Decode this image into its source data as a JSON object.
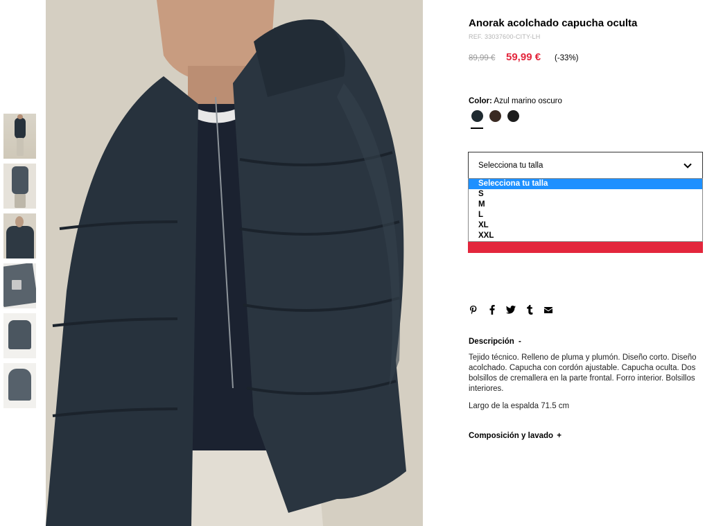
{
  "thumbnails": [
    {
      "alt": "thumbnail-1"
    },
    {
      "alt": "thumbnail-2"
    },
    {
      "alt": "thumbnail-3"
    },
    {
      "alt": "thumbnail-4"
    },
    {
      "alt": "thumbnail-5"
    },
    {
      "alt": "thumbnail-6"
    }
  ],
  "product": {
    "title": "Anorak acolchado capucha oculta",
    "ref": "REF. 33037600-CITY-LH",
    "price_old": "89,99 €",
    "price_new": "59,99 €",
    "discount": "(-33%)"
  },
  "color": {
    "label": "Color:",
    "value": "Azul marino oscuro",
    "swatches": [
      {
        "name": "navy",
        "hex": "#1f2a30",
        "active": true
      },
      {
        "name": "brown",
        "hex": "#3a2a22",
        "active": false
      },
      {
        "name": "black",
        "hex": "#1c1c1c",
        "active": false
      }
    ]
  },
  "size": {
    "placeholder": "Selecciona tu talla",
    "options": [
      "Selecciona tu talla",
      "S",
      "M",
      "L",
      "XL",
      "XXL"
    ],
    "highlighted_index": 0
  },
  "share": {
    "icons": [
      "pinterest-icon",
      "facebook-icon",
      "twitter-icon",
      "tumblr-icon",
      "email-icon"
    ]
  },
  "description": {
    "title": "Descripción",
    "toggle": "-",
    "text": "Tejido técnico. Relleno de pluma y plumón. Diseño corto. Diseño acolchado. Capucha con cordón ajustable. Capucha oculta. Dos bolsillos de cremallera en la parte frontal. Forro interior. Bolsillos interiores.",
    "length": "Largo de la espalda 71.5 cm"
  },
  "composition": {
    "title": "Composición y lavado",
    "toggle": "+"
  },
  "colors": {
    "accent_red": "#e3263c",
    "select_blue": "#1e90ff"
  }
}
